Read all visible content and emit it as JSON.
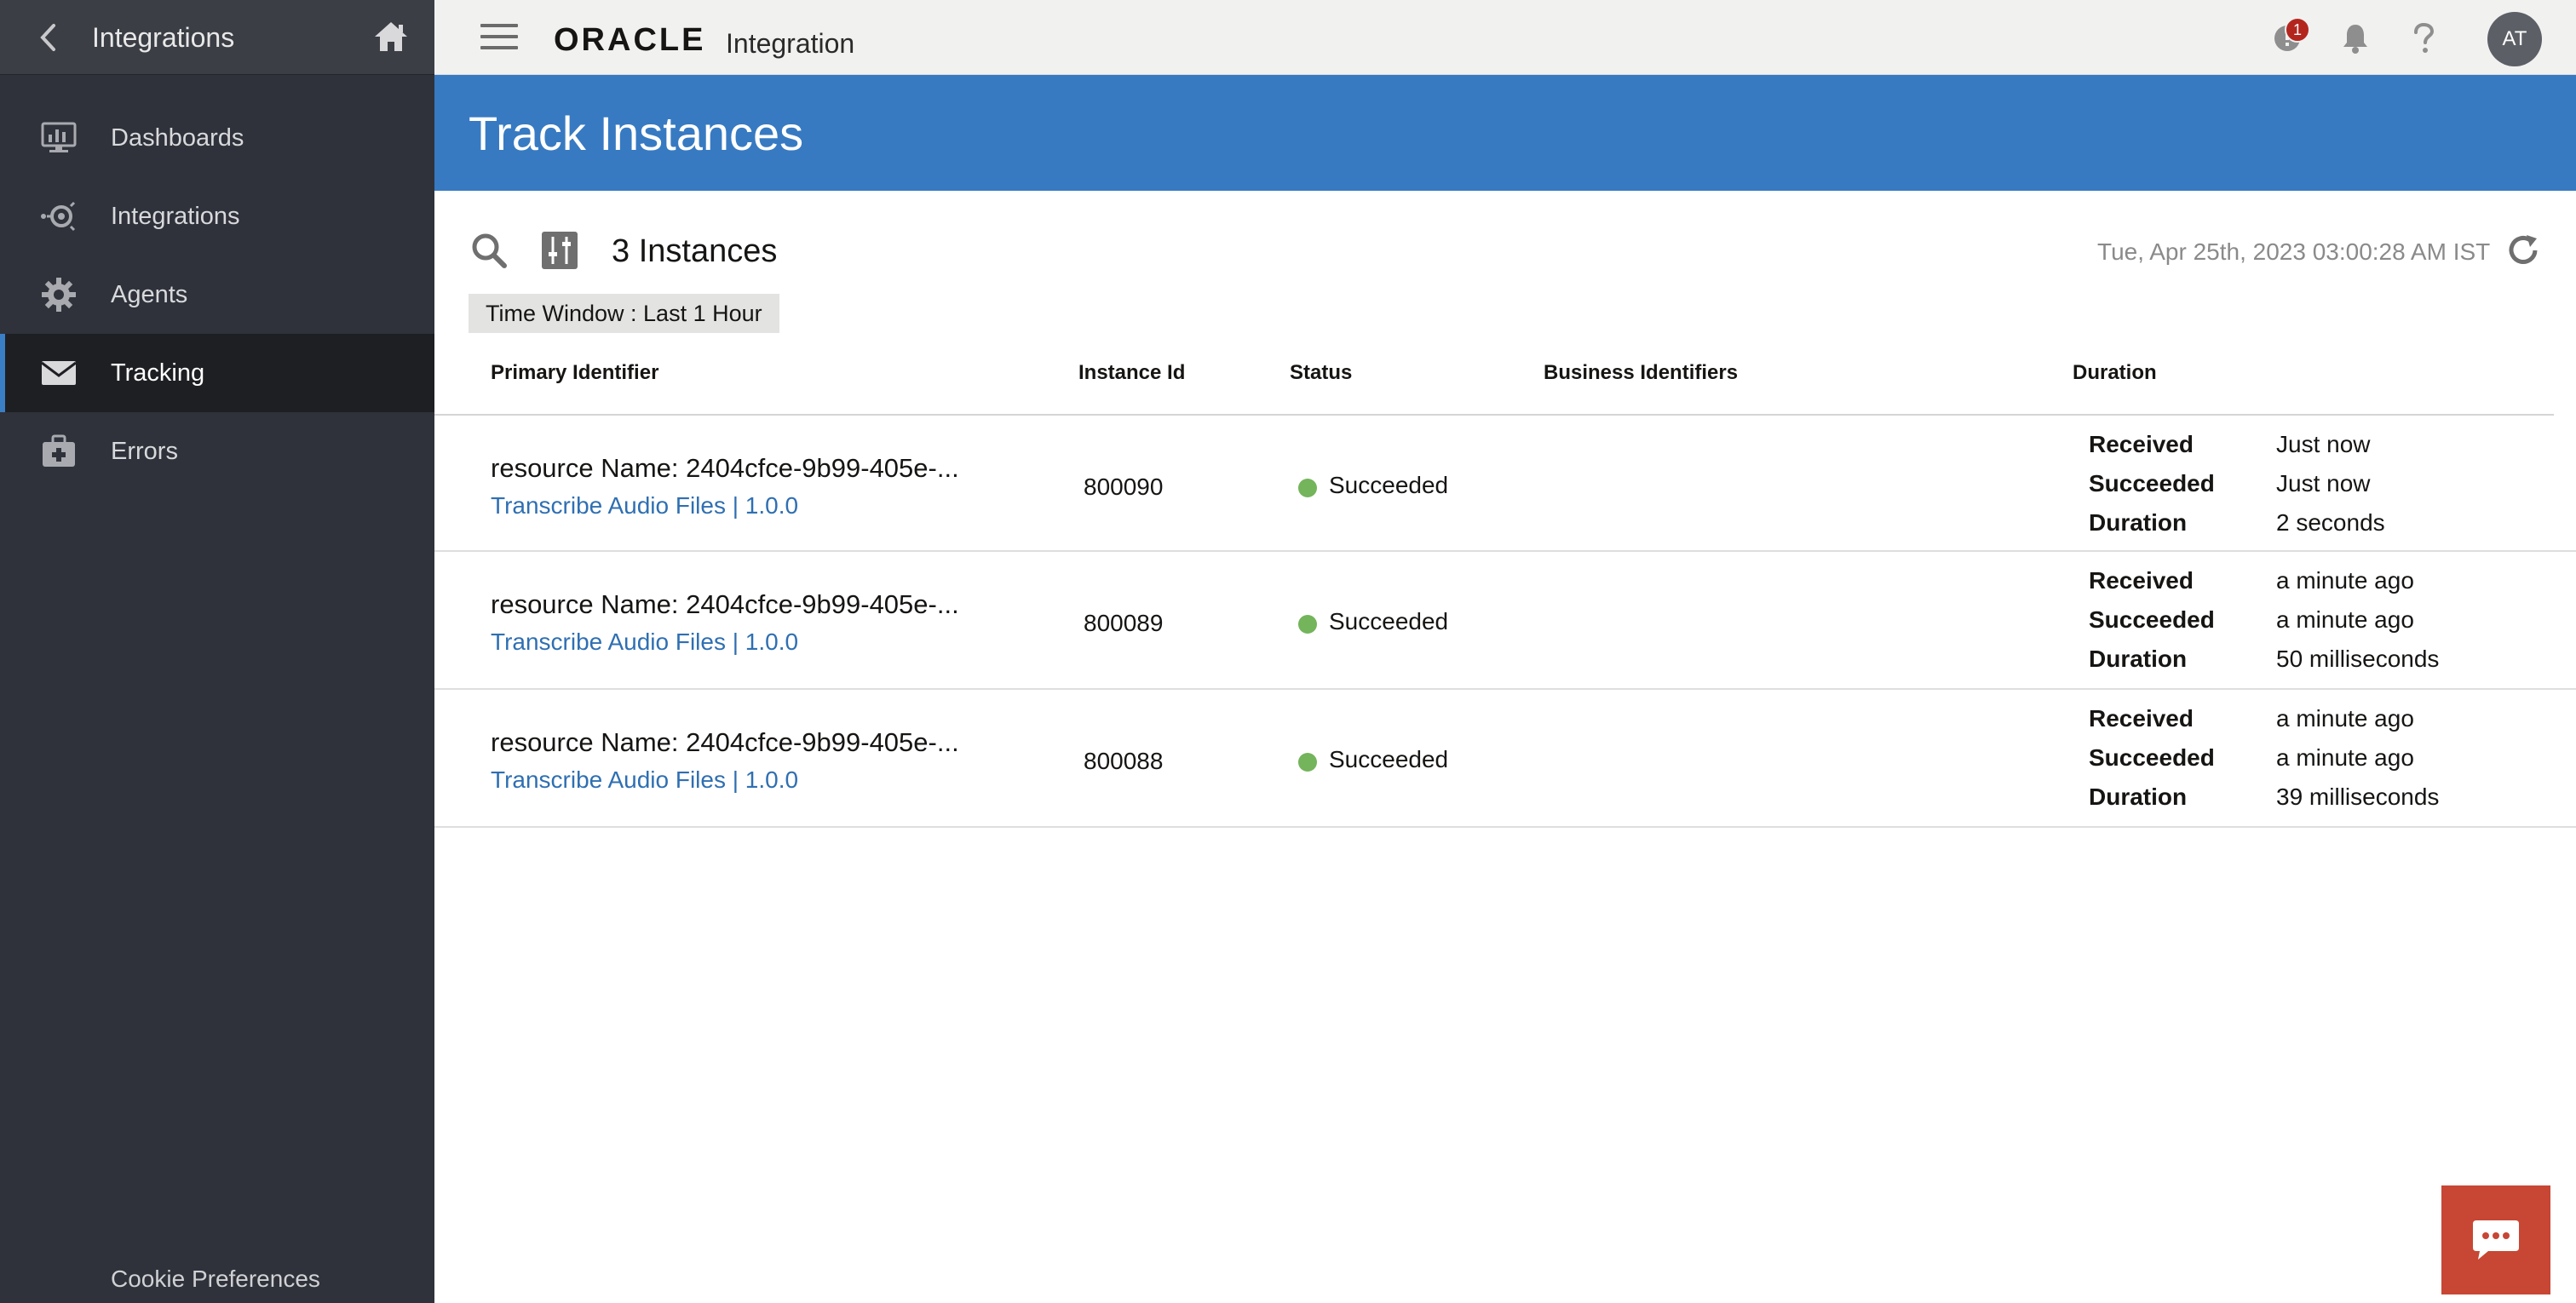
{
  "colors": {
    "accent": "#377ac2",
    "sidebar": "#2f323a",
    "status_success": "#74b45b",
    "badge": "#b3261e",
    "chat": "#c74634",
    "link": "#2f6fb2"
  },
  "sidebar": {
    "title": "Integrations",
    "items": [
      {
        "label": "Dashboards",
        "icon": "monitor-icon",
        "active": false
      },
      {
        "label": "Integrations",
        "icon": "integrations-icon",
        "active": false
      },
      {
        "label": "Agents",
        "icon": "gear-icon",
        "active": false
      },
      {
        "label": "Tracking",
        "icon": "envelope-icon",
        "active": true
      },
      {
        "label": "Errors",
        "icon": "medical-kit-icon",
        "active": false
      }
    ],
    "cookie_label": "Cookie Preferences"
  },
  "topbar": {
    "brand": "ORACLE",
    "product": "Integration",
    "notification_count": "1",
    "avatar_initials": "AT"
  },
  "page": {
    "title": "Track Instances",
    "instance_count": "3 Instances",
    "timestamp": "Tue, Apr 25th, 2023 03:00:28 AM IST",
    "time_window": "Time Window : Last 1 Hour"
  },
  "table": {
    "headers": {
      "primary": "Primary Identifier",
      "instance_id": "Instance Id",
      "status": "Status",
      "business": "Business Identifiers",
      "duration": "Duration"
    },
    "duration_labels": {
      "received": "Received",
      "succeeded": "Succeeded",
      "duration": "Duration"
    },
    "rows": [
      {
        "primary": "resource Name: 2404cfce-9b99-405e-...",
        "integration": "Transcribe Audio Files | 1.0.0",
        "instance_id": "800090",
        "status": "Succeeded",
        "received": "Just now",
        "succeeded": "Just now",
        "duration": "2 seconds"
      },
      {
        "primary": "resource Name: 2404cfce-9b99-405e-...",
        "integration": "Transcribe Audio Files | 1.0.0",
        "instance_id": "800089",
        "status": "Succeeded",
        "received": "a minute ago",
        "succeeded": "a minute ago",
        "duration": "50 milliseconds"
      },
      {
        "primary": "resource Name: 2404cfce-9b99-405e-...",
        "integration": "Transcribe Audio Files | 1.0.0",
        "instance_id": "800088",
        "status": "Succeeded",
        "received": "a minute ago",
        "succeeded": "a minute ago",
        "duration": "39 milliseconds"
      }
    ]
  }
}
